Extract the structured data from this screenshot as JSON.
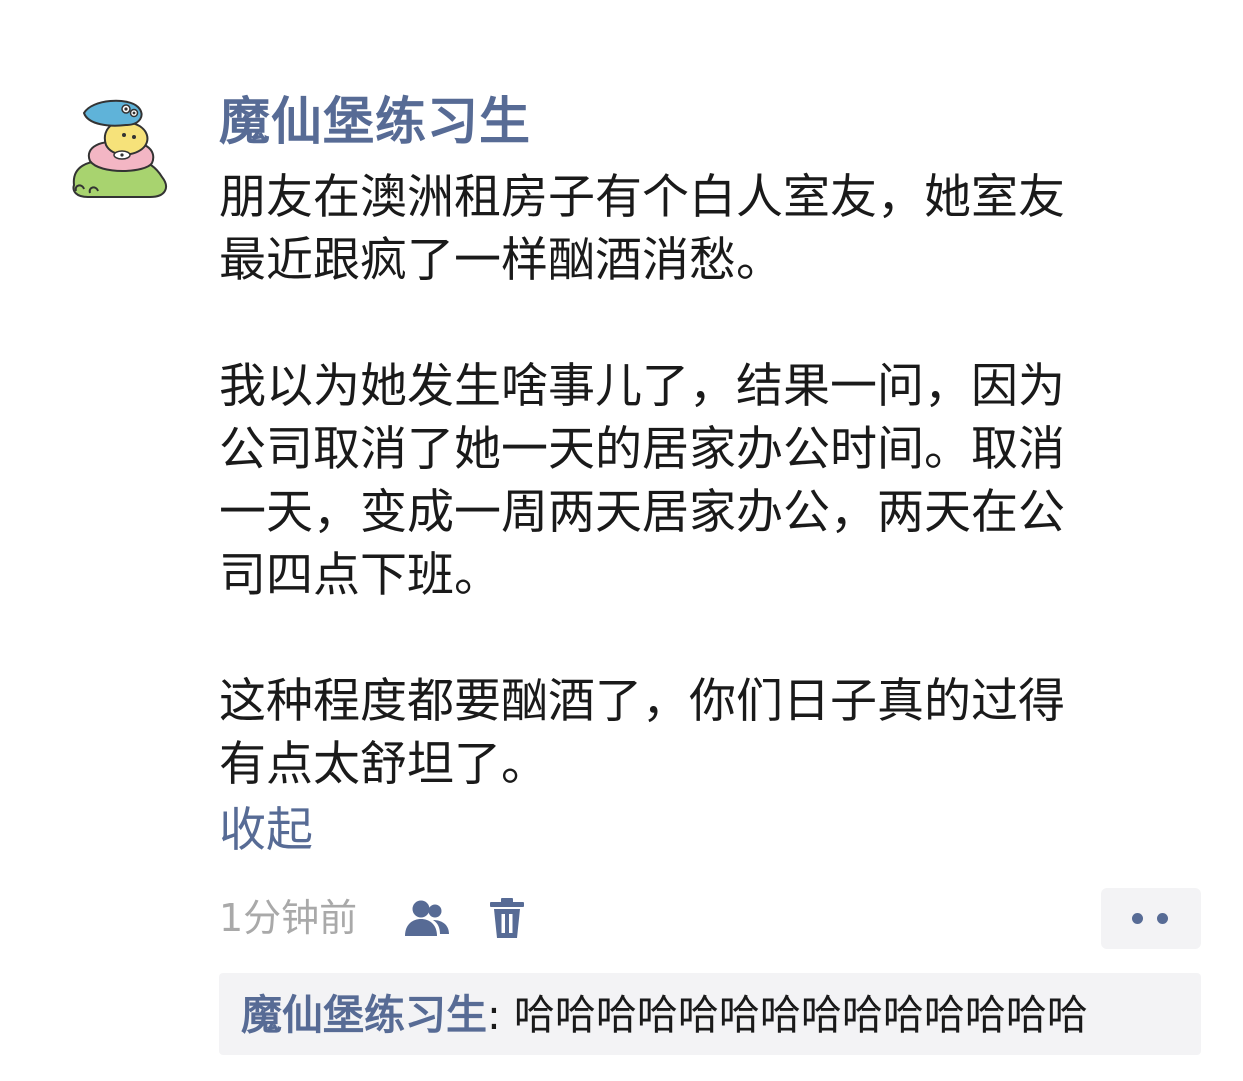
{
  "post": {
    "author": "魔仙堡练习生",
    "paragraphs": [
      {
        "lines": [
          "朋友在澳洲租房子有个白人室友，她室友",
          "最近跟疯了一样酗酒消愁。"
        ]
      },
      {
        "lines": [
          "我以为她发生啥事儿了，结果一问，因为",
          "公司取消了她一天的居家办公时间。取消",
          "一天，变成一周两天居家办公，两天在公",
          "司四点下班。"
        ]
      },
      {
        "lines": [
          "这种程度都要酗酒了，你们日子真的过得",
          "有点太舒坦了。"
        ]
      }
    ],
    "collapse_label": "收起",
    "time": "1分钟前",
    "icons": {
      "avatar": "cartoon-avatar",
      "visibility": "friends-icon",
      "delete": "trash-icon",
      "more": "more-dots-icon"
    },
    "colors": {
      "link": "#576b95",
      "text": "#1a1a1a",
      "muted": "#a9a9a9",
      "panel": "#f3f3f5"
    }
  },
  "comments": [
    {
      "author": "魔仙堡练习生",
      "separator": ": ",
      "text": "哈哈哈哈哈哈哈哈哈哈哈哈哈哈"
    }
  ]
}
